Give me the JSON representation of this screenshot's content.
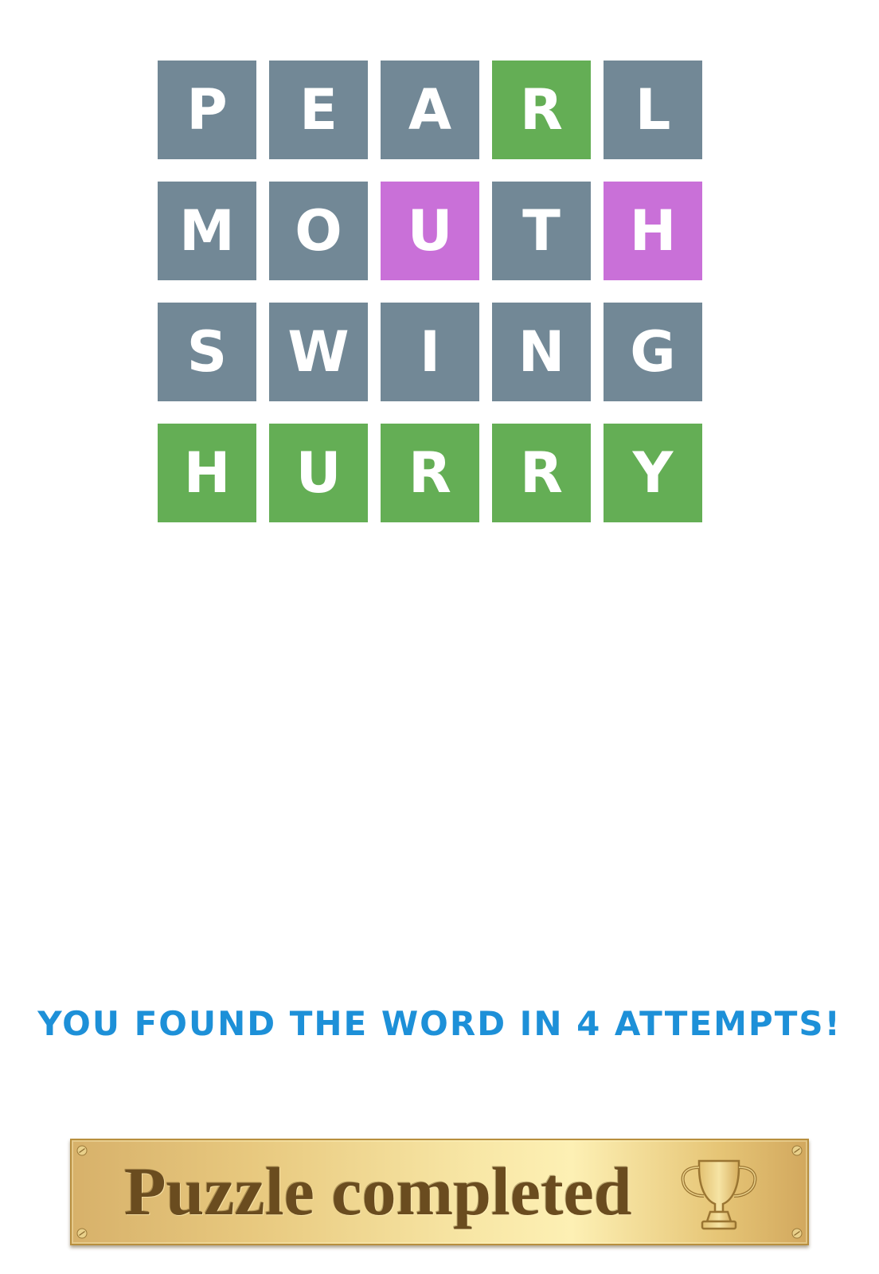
{
  "board": {
    "rows": [
      [
        {
          "letter": "P",
          "state": "absent"
        },
        {
          "letter": "E",
          "state": "absent"
        },
        {
          "letter": "A",
          "state": "absent"
        },
        {
          "letter": "R",
          "state": "correct"
        },
        {
          "letter": "L",
          "state": "absent"
        }
      ],
      [
        {
          "letter": "M",
          "state": "absent"
        },
        {
          "letter": "O",
          "state": "absent"
        },
        {
          "letter": "U",
          "state": "present"
        },
        {
          "letter": "T",
          "state": "absent"
        },
        {
          "letter": "H",
          "state": "present"
        }
      ],
      [
        {
          "letter": "S",
          "state": "absent"
        },
        {
          "letter": "W",
          "state": "absent"
        },
        {
          "letter": "I",
          "state": "absent"
        },
        {
          "letter": "N",
          "state": "absent"
        },
        {
          "letter": "G",
          "state": "absent"
        }
      ],
      [
        {
          "letter": "H",
          "state": "correct"
        },
        {
          "letter": "U",
          "state": "correct"
        },
        {
          "letter": "R",
          "state": "correct"
        },
        {
          "letter": "R",
          "state": "correct"
        },
        {
          "letter": "Y",
          "state": "correct"
        }
      ]
    ]
  },
  "colors": {
    "absent": "#728896",
    "correct": "#64ae55",
    "present": "#c970d8",
    "message": "#1d90d8",
    "plaque_text": "#6a4c1f"
  },
  "result": {
    "message": "YOU FOUND THE WORD IN 4 ATTEMPTS!"
  },
  "plaque": {
    "text": "Puzzle completed",
    "icon": "trophy-icon"
  }
}
